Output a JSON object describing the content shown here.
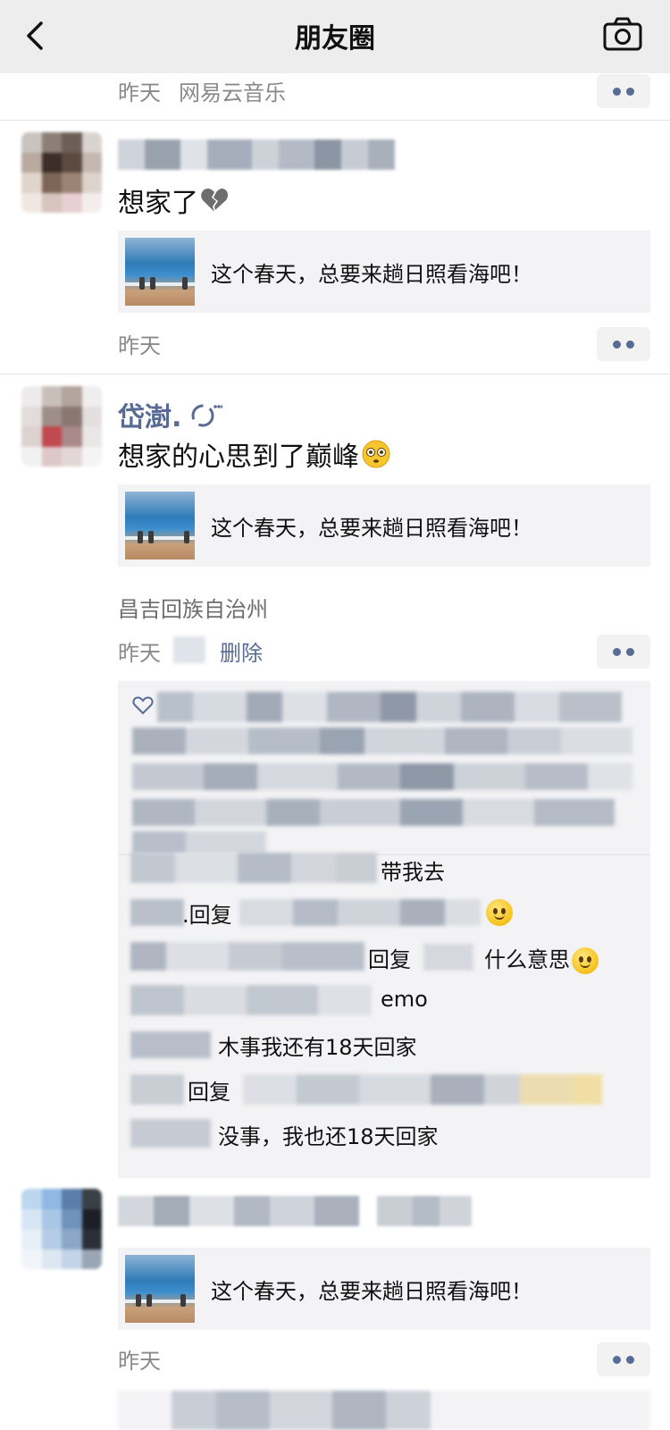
{
  "navbar": {
    "title": "朋友圈",
    "back_icon": "chevron-left-icon",
    "camera_icon": "camera-icon"
  },
  "posts": [
    {
      "time": "昨天",
      "source": "网易云音乐"
    },
    {
      "text": "想家了",
      "emoji": "broken-heart-icon",
      "link_title": "这个春天，总要来趟日照看海吧！",
      "time": "昨天"
    },
    {
      "username": "岱澍.",
      "text": "想家的心思到了巅峰",
      "emoji": "flushed-face-icon",
      "link_title": "这个春天，总要来趟日照看海吧！",
      "location": "昌吉回族自治州",
      "time": "昨天",
      "delete_label": "删除",
      "comments": [
        {
          "text": "带我去"
        },
        {
          "prefix": ".回复",
          "text": ""
        },
        {
          "prefix": "回复",
          "text": "什么意思"
        },
        {
          "text": "emo"
        },
        {
          "text": "木事我还有18天回家"
        },
        {
          "prefix": "回复",
          "text": ""
        },
        {
          "text": "没事，我也还18天回家"
        }
      ]
    },
    {
      "link_title": "这个春天，总要来趟日照看海吧！",
      "time": "昨天"
    }
  ],
  "colors": {
    "navbar_bg": "#ededed",
    "link_blue": "#576b95",
    "card_bg": "#f3f3f5",
    "meta_gray": "#8a8a8a"
  }
}
